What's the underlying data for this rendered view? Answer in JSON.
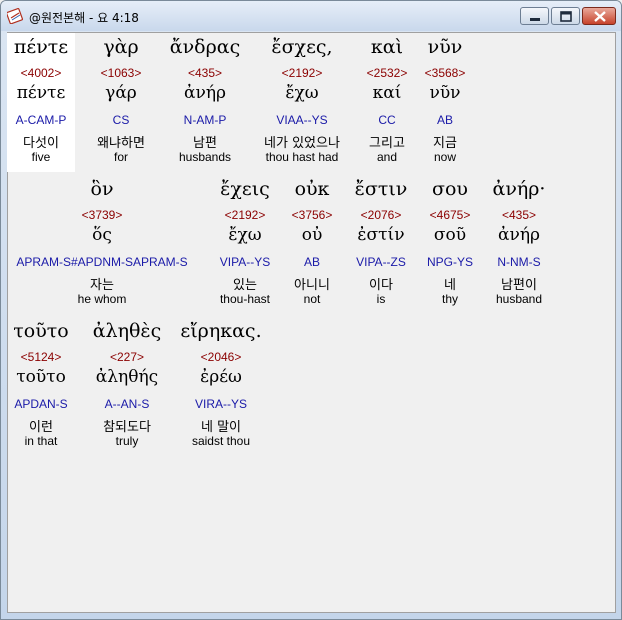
{
  "window": {
    "title": "@원전본해 - 요 4:18",
    "icons": {
      "app": "bible-app-icon",
      "minimize": "minimize-icon",
      "maximize": "maximize-icon",
      "close": "close-icon"
    }
  },
  "words": [
    {
      "greek": "πέντε",
      "strong": "<4002>",
      "lemma": "πέντε",
      "morph": "A-CAM-P",
      "korean": "다섯이",
      "english": "five"
    },
    {
      "greek": "γὰρ",
      "strong": "<1063>",
      "lemma": "γάρ",
      "morph": "CS",
      "korean": "왜냐하면",
      "english": "for"
    },
    {
      "greek": "ἄνδρας",
      "strong": "<435>",
      "lemma": "ἀνήρ",
      "morph": "N-AM-P",
      "korean": "남편",
      "english": "husbands"
    },
    {
      "greek": "ἔσχες,",
      "strong": "<2192>",
      "lemma": "ἔχω",
      "morph": "VIAA--YS",
      "korean": "네가 있었으나",
      "english": "thou hast had"
    },
    {
      "greek": "καὶ",
      "strong": "<2532>",
      "lemma": "καί",
      "morph": "CC",
      "korean": "그리고",
      "english": "and"
    },
    {
      "greek": "νῦν",
      "strong": "<3568>",
      "lemma": "νῦν",
      "morph": "AB",
      "korean": "지금",
      "english": "now"
    },
    {
      "greek": "ὃν",
      "strong": "<3739>",
      "lemma": "ὅς",
      "morph": "APRAM-S#APDNM-SAPRAM-S",
      "korean": "자는",
      "english": "he whom"
    },
    {
      "greek": "ἔχεις",
      "strong": "<2192>",
      "lemma": "ἔχω",
      "morph": "VIPA--YS",
      "korean": "있는",
      "english": "thou-hast"
    },
    {
      "greek": "οὐκ",
      "strong": "<3756>",
      "lemma": "οὐ",
      "morph": "AB",
      "korean": "아니니",
      "english": "not"
    },
    {
      "greek": "ἔστιν",
      "strong": "<2076>",
      "lemma": "ἐστίν",
      "morph": "VIPA--ZS",
      "korean": "이다",
      "english": "is"
    },
    {
      "greek": "σου",
      "strong": "<4675>",
      "lemma": "σοῦ",
      "morph": "NPG-YS",
      "korean": "네",
      "english": "thy"
    },
    {
      "greek": "ἀνήρ·",
      "strong": "<435>",
      "lemma": "ἀνήρ",
      "morph": "N-NM-S",
      "korean": "남편이",
      "english": "husband"
    },
    {
      "greek": "τοῦτο",
      "strong": "<5124>",
      "lemma": "τοῦτο",
      "morph": "APDAN-S",
      "korean": "이런",
      "english": "in that"
    },
    {
      "greek": "ἀληθὲς",
      "strong": "<227>",
      "lemma": "ἀληθής",
      "morph": "A--AN-S",
      "korean": "참되도다",
      "english": "truly"
    },
    {
      "greek": "εἴρηκας.",
      "strong": "<2046>",
      "lemma": "ἐρέω",
      "morph": "VIRA--YS",
      "korean": "네 말이",
      "english": "saidst thou"
    }
  ]
}
